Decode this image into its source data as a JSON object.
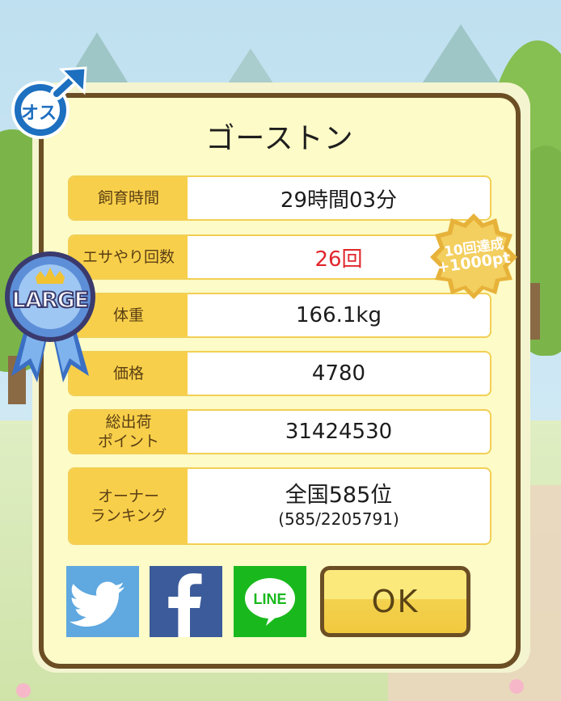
{
  "dialog": {
    "title": "ゴーストン"
  },
  "stats": [
    {
      "label": "飼育時間",
      "value": "29時間03分"
    },
    {
      "label": "エサやり回数",
      "value": "26回"
    },
    {
      "label": "体重",
      "value": "166.1kg"
    },
    {
      "label": "価格",
      "value": "4780"
    },
    {
      "label": "総出荷\nポイント",
      "value": "31424530"
    },
    {
      "label": "オーナー\nランキング",
      "value": "全国585位",
      "sub_value": "(585/2205791)"
    }
  ],
  "badges": {
    "gender": "オス",
    "size": "LARGE",
    "bonus_line1": "10回達成",
    "bonus_line2": "+1000pt"
  },
  "buttons": {
    "twitter": "twitter-icon",
    "facebook": "facebook-icon",
    "line": "LINE",
    "ok": "OK"
  },
  "colors": {
    "label_bg": "#f8cf4a",
    "accent_red": "#e0262c",
    "frame_brown": "#6b4e24",
    "twitter_blue": "#5fa8e0",
    "facebook_blue": "#3b5b9a",
    "line_green": "#19b91d"
  }
}
